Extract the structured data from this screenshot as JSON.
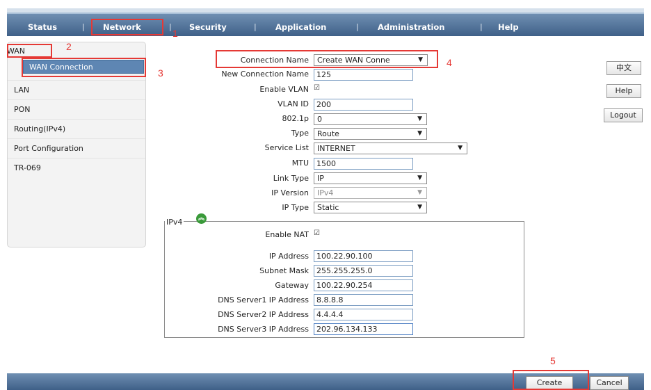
{
  "nav": {
    "items": [
      "Status",
      "Network",
      "Security",
      "Application",
      "Administration",
      "Help"
    ],
    "separator": "|"
  },
  "sidebar": {
    "items": [
      "WAN",
      "WAN Connection",
      "LAN",
      "PON",
      "Routing(IPv4)",
      "Port Configuration",
      "TR-069"
    ]
  },
  "form": {
    "connection_name": {
      "label": "Connection Name",
      "value": "Create WAN Conne"
    },
    "new_connection_name": {
      "label": "New Connection Name",
      "value": "125"
    },
    "enable_vlan": {
      "label": "Enable VLAN",
      "checked": true
    },
    "vlan_id": {
      "label": "VLAN ID",
      "value": "200"
    },
    "dot1p": {
      "label": "802.1p",
      "value": "0"
    },
    "type": {
      "label": "Type",
      "value": "Route"
    },
    "service_list": {
      "label": "Service List",
      "value": "INTERNET"
    },
    "mtu": {
      "label": "MTU",
      "value": "1500"
    },
    "link_type": {
      "label": "Link Type",
      "value": "IP"
    },
    "ip_version": {
      "label": "IP Version",
      "value": "IPv4"
    },
    "ip_type": {
      "label": "IP Type",
      "value": "Static"
    }
  },
  "ipv4": {
    "legend": "IPv4",
    "enable_nat": {
      "label": "Enable NAT",
      "checked": true
    },
    "ip_address": {
      "label": "IP Address",
      "value": "100.22.90.100"
    },
    "subnet_mask": {
      "label": "Subnet Mask",
      "value": "255.255.255.0"
    },
    "gateway": {
      "label": "Gateway",
      "value": "100.22.90.254"
    },
    "dns1": {
      "label": "DNS Server1 IP Address",
      "value": "8.8.8.8"
    },
    "dns2": {
      "label": "DNS Server2 IP Address",
      "value": "4.4.4.4"
    },
    "dns3": {
      "label": "DNS Server3 IP Address",
      "value": "202.96.134.133"
    }
  },
  "right_buttons": {
    "lang": "中文",
    "help": "Help",
    "logout": "Logout"
  },
  "bottom_buttons": {
    "create": "Create",
    "cancel": "Cancel"
  },
  "annotations": [
    "1",
    "2",
    "3",
    "4",
    "5"
  ],
  "colors": {
    "nav_bar": "#4f6f96",
    "sidebar_active": "#5e86b3",
    "annotation": "#e53935",
    "input_border": "#7a9cc2"
  }
}
